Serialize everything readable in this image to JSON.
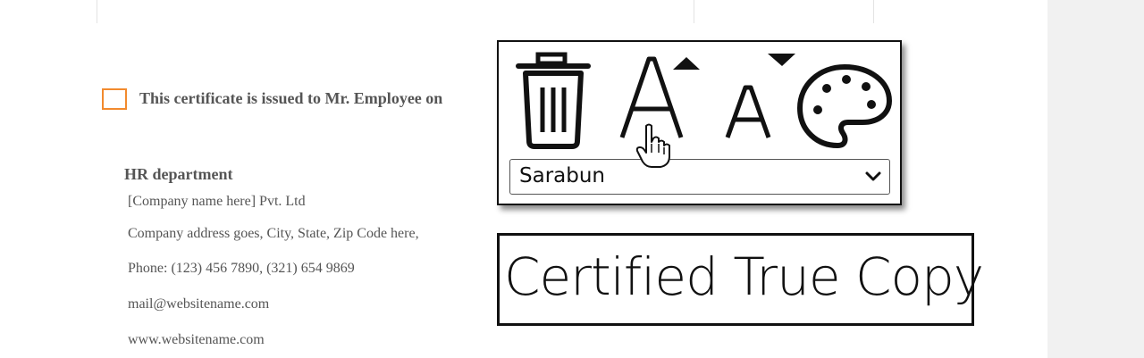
{
  "document": {
    "certificate_text": "This certificate is issued to Mr. Employee on",
    "hr": {
      "title": "HR department",
      "company_name": "[Company name here] Pvt. Ltd",
      "address": "Company address goes, City, State, Zip Code  here,",
      "phone": "Phone: (123) 456 7890,  (321) 654 9869",
      "email": "mail@websitename.com",
      "website": "www.websitename.com"
    }
  },
  "toolbar": {
    "icons": [
      "trash-icon",
      "font-size-increase-icon",
      "font-size-decrease-icon",
      "palette-icon"
    ],
    "font_select": {
      "selected": "Sarabun"
    }
  },
  "stamp": {
    "text": "Certified True Copy"
  },
  "colors": {
    "checkbox_border": "#f28a2e",
    "text": "#555555",
    "stamp_border": "#111111"
  }
}
